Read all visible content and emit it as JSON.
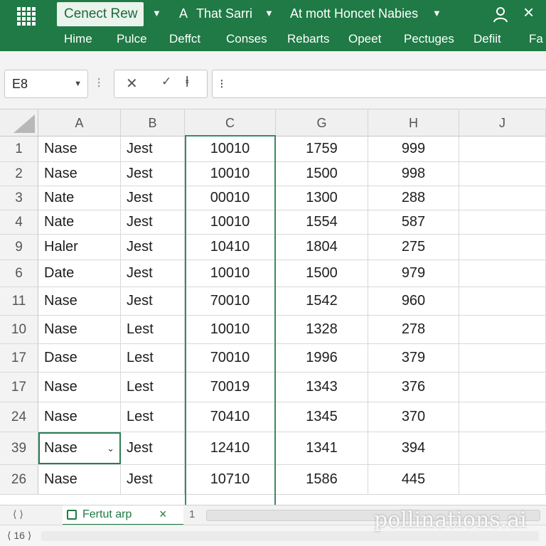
{
  "colors": {
    "ribbon": "#1f7a45",
    "selection": "#2a7d55"
  },
  "ribbon": {
    "doc_title": "Cenect Rew",
    "item_one": "That Sarri",
    "item_two": "At mott Honcet Nabies",
    "menu": [
      "Hime",
      "Pulce",
      "Deffct",
      "Conses",
      "Rebarts",
      "Opeet",
      "Pectuges",
      "Defiit",
      "Fa"
    ]
  },
  "formula_bar": {
    "name_box": "E8",
    "formula_value": "⁝"
  },
  "columns": [
    "A",
    "B",
    "C",
    "G",
    "H",
    "J"
  ],
  "rows": [
    {
      "num": "1",
      "a": "Nase",
      "b": "Jest",
      "c": "10010",
      "g": "1759",
      "h": "999"
    },
    {
      "num": "2",
      "a": "Nase",
      "b": "Jest",
      "c": "10010",
      "g": "1500",
      "h": "998"
    },
    {
      "num": "3",
      "a": "Nate",
      "b": "Jest",
      "c": "00010",
      "g": "1300",
      "h": "288"
    },
    {
      "num": "4",
      "a": "Nate",
      "b": "Jest",
      "c": "10010",
      "g": "1554",
      "h": "587"
    },
    {
      "num": "9",
      "a": "Haler",
      "b": "Jest",
      "c": "10410",
      "g": "1804",
      "h": "275"
    },
    {
      "num": "6",
      "a": "Date",
      "b": "Jest",
      "c": "10010",
      "g": "1500",
      "h": "979"
    },
    {
      "num": "11",
      "a": "Nase",
      "b": "Jest",
      "c": "70010",
      "g": "1542",
      "h": "960"
    },
    {
      "num": "10",
      "a": "Nase",
      "b": "Lest",
      "c": "10010",
      "g": "1328",
      "h": "278"
    },
    {
      "num": "17",
      "a": "Dase",
      "b": "Lest",
      "c": "70010",
      "g": "1996",
      "h": "379"
    },
    {
      "num": "17",
      "a": "Nase",
      "b": "Lest",
      "c": "70019",
      "g": "1343",
      "h": "376"
    },
    {
      "num": "24",
      "a": "Nase",
      "b": "Lest",
      "c": "70410",
      "g": "1345",
      "h": "370"
    },
    {
      "num": "39",
      "a": "Nase",
      "b": "Jest",
      "c": "12410",
      "g": "1341",
      "h": "394"
    },
    {
      "num": "26",
      "a": "Nase",
      "b": "Jest",
      "c": "10710",
      "g": "1586",
      "h": "445"
    }
  ],
  "sheet_tabs": {
    "nav": "⟨ ⟩",
    "active": "Fertut arp",
    "extra": "1"
  },
  "status": {
    "nav": "⟨ 16 ⟩"
  },
  "watermark": "pollinations.ai"
}
